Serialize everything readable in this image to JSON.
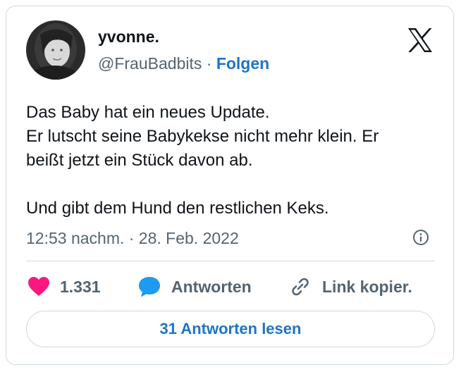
{
  "author": {
    "name": "yvonne.",
    "handle": "@FrauBadbits",
    "separator": " · ",
    "follow_label": "Folgen"
  },
  "tweet": {
    "lines": [
      "Das Baby hat ein neues Update.",
      "Er lutscht seine Babykekse nicht mehr klein. Er",
      "beißt jetzt ein Stück davon ab.",
      "Und gibt dem Hund den restlichen Keks."
    ],
    "timestamp": "12:53 nachm. · 28. Feb. 2022"
  },
  "actions": {
    "like_count": "1.331",
    "reply_label": "Antworten",
    "link_label": "Link kopier."
  },
  "read_replies_label": "31 Antworten lesen",
  "colors": {
    "link_blue": "#1d74c9",
    "like_red": "#f91880",
    "reply_blue": "#1d9bf0",
    "muted_text": "#536471",
    "border": "#cfd9de"
  }
}
